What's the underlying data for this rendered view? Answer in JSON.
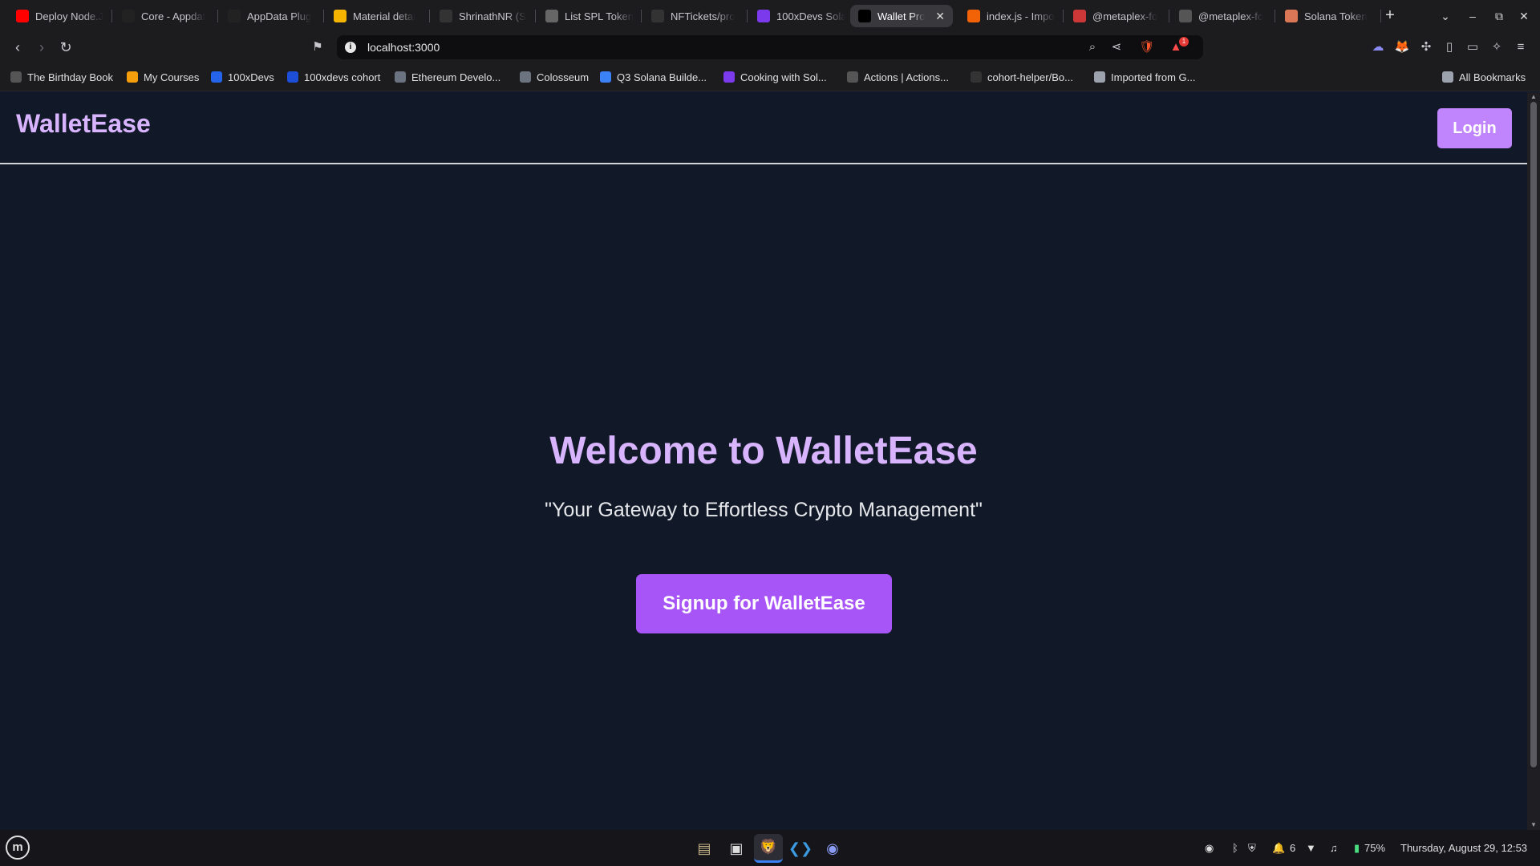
{
  "browser": {
    "tabs": [
      {
        "title": "Deploy Node.J",
        "icon": "youtube-icon",
        "color": "#ff0000"
      },
      {
        "title": "Core - Appdat",
        "icon": "metaplex-icon",
        "color": "#222222"
      },
      {
        "title": "AppData Plug",
        "icon": "metaplex-icon",
        "color": "#222222"
      },
      {
        "title": "Material detai",
        "icon": "image-icon",
        "color": "#f4b400"
      },
      {
        "title": "ShrinathNR (S",
        "icon": "github-icon",
        "color": "#333333"
      },
      {
        "title": "List SPL Token",
        "icon": "chatgpt-icon",
        "color": "#666666"
      },
      {
        "title": "NFTickets/pro",
        "icon": "github-icon",
        "color": "#333333"
      },
      {
        "title": "100xDevs Sola",
        "icon": "100xdevs-icon",
        "color": "#7c3aed"
      },
      {
        "title": "Wallet Pro",
        "icon": "vercel-icon",
        "color": "#000000",
        "active": true
      },
      {
        "title": "index.js - Impo",
        "icon": "replit-icon",
        "color": "#f26207"
      },
      {
        "title": "@metaplex-fo",
        "icon": "npm-icon",
        "color": "#cb3837"
      },
      {
        "title": "@metaplex-fo",
        "icon": "globe-icon",
        "color": "#555555"
      },
      {
        "title": "Solana Token",
        "icon": "claude-icon",
        "color": "#d97757"
      }
    ],
    "url": "localhost:3000",
    "bookmarks": [
      {
        "label": "The Birthday Book",
        "icon": "globe-icon",
        "color": "#555555"
      },
      {
        "label": "My Courses",
        "icon": "courses-icon",
        "color": "#f59e0b"
      },
      {
        "label": "100xDevs",
        "icon": "100xdevs-icon",
        "color": "#2563eb"
      },
      {
        "label": "100xdevs cohort",
        "icon": "cohort-icon",
        "color": "#1d4ed8"
      },
      {
        "label": "Ethereum Develo...",
        "icon": "ethereum-icon",
        "color": "#6b7280"
      },
      {
        "label": "Colosseum",
        "icon": "colosseum-icon",
        "color": "#6b7280"
      },
      {
        "label": "Q3 Solana Builde...",
        "icon": "image-icon",
        "color": "#3b82f6"
      },
      {
        "label": "Cooking with Sol...",
        "icon": "cooking-icon",
        "color": "#7c3aed"
      },
      {
        "label": "Actions | Actions...",
        "icon": "actions-icon",
        "color": "#555555"
      },
      {
        "label": "cohort-helper/Bo...",
        "icon": "github-icon",
        "color": "#333333"
      },
      {
        "label": "Imported from G...",
        "icon": "folder-icon",
        "color": "#9ca3af"
      }
    ],
    "all_bookmarks_label": "All Bookmarks",
    "notification_count": "1"
  },
  "page": {
    "brand": "WalletEase",
    "login_label": "Login",
    "hero_title": "Welcome to WalletEase",
    "hero_subtitle": "\"Your Gateway to Effortless Crypto Management\"",
    "signup_label": "Signup for WalletEase",
    "colors": {
      "background": "#111827",
      "accent": "#d8b4fe",
      "login_bg": "#c084fc",
      "signup_bg": "#a855f7"
    }
  },
  "taskbar": {
    "apps": [
      "files-icon",
      "terminal-icon",
      "brave-icon",
      "vscode-icon",
      "discord-icon"
    ],
    "notifications_count": "6",
    "battery": "75%",
    "datetime": "Thursday, August 29, 12:53"
  }
}
